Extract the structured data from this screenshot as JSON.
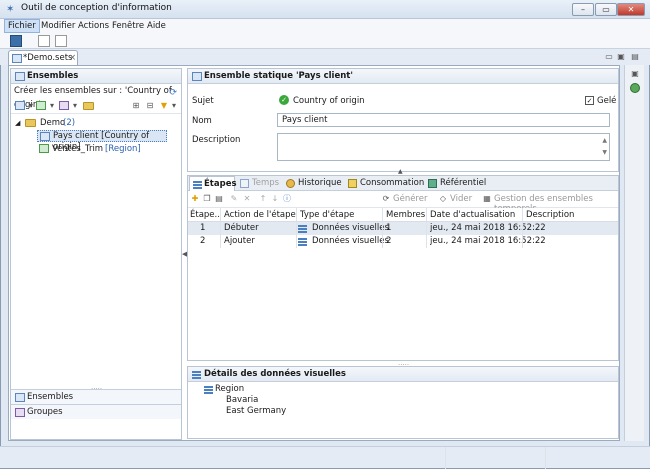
{
  "window": {
    "title": "Outil de conception d'information"
  },
  "menu": [
    "Fichier",
    "Modifier",
    "Actions",
    "Fenêtre",
    "Aide"
  ],
  "editor_tab": {
    "label": "*Demo.sets"
  },
  "left": {
    "header": "Ensembles",
    "create_label": "Créer les ensembles sur : 'Country of origin'",
    "tree": {
      "root": "Demo",
      "root_count": "(2)",
      "items": [
        {
          "label": "Pays client [Country of origin]",
          "selected": true
        },
        {
          "label": "Ventes_Trim",
          "suffix": "[Region]"
        }
      ]
    },
    "bottom_tabs": [
      "Ensembles",
      "Groupes"
    ]
  },
  "detail": {
    "header": "Ensemble statique 'Pays client'",
    "subject_label": "Sujet",
    "subject_value": "Country of origin",
    "frozen_label": "Gelé",
    "name_label": "Nom",
    "name_value": "Pays client",
    "description_label": "Description"
  },
  "subtabs": [
    "Étapes",
    "Temps",
    "Historique",
    "Consommation",
    "Référentiel"
  ],
  "steps_toolbar": {
    "generate": "Générer",
    "empty": "Vider",
    "manage": "Gestion des ensembles temporels..."
  },
  "grid": {
    "columns": [
      "Étape...",
      "Action de l'étape",
      "Type d'étape",
      "Membres",
      "Date d'actualisation",
      "Description"
    ],
    "rows": [
      [
        "1",
        "Débuter",
        "Données visuelles",
        "1",
        "jeu., 24 mai 2018 16:52:22",
        ""
      ],
      [
        "2",
        "Ajouter",
        "Données visuelles",
        "2",
        "jeu., 24 mai 2018 16:52:22",
        ""
      ]
    ]
  },
  "visual_details": {
    "header": "Détails des données visuelles",
    "root": "Region",
    "children": [
      "Bavaria",
      "East Germany"
    ]
  }
}
